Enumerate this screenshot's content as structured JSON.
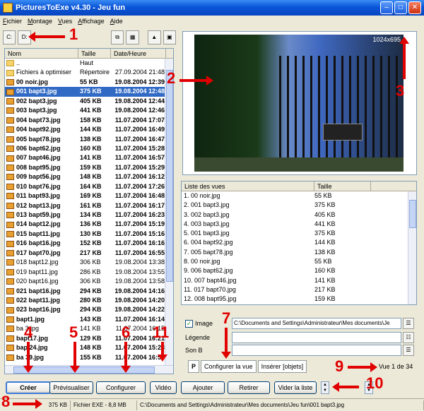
{
  "window": {
    "title": "PicturesToExe v4.30 - Jeu fun"
  },
  "menu": [
    "Fichier",
    "Montage",
    "Vues",
    "Affichage",
    "Aide"
  ],
  "file_list": {
    "columns": [
      "Nom",
      "Taille",
      "Date/Heure"
    ],
    "rows": [
      {
        "name": "..",
        "size": "Haut",
        "date": "",
        "icon": "folder",
        "bold": false,
        "selected": false
      },
      {
        "name": "Fichiers à optimiser",
        "size": "Répertoire",
        "date": "27.09.2004 21:48",
        "icon": "folder",
        "bold": false,
        "selected": false
      },
      {
        "name": "00 noir.jpg",
        "size": "55 KB",
        "date": "19.08.2004 12:39",
        "icon": "image",
        "bold": true,
        "selected": false
      },
      {
        "name": "001 bapt3.jpg",
        "size": "375 KB",
        "date": "19.08.2004 12:48",
        "icon": "image",
        "bold": true,
        "selected": true
      },
      {
        "name": "002 bapt3.jpg",
        "size": "405 KB",
        "date": "19.08.2004 12:44",
        "icon": "image",
        "bold": true,
        "selected": false
      },
      {
        "name": "003 bapt3.jpg",
        "size": "441 KB",
        "date": "19.08.2004 12:46",
        "icon": "image",
        "bold": true,
        "selected": false
      },
      {
        "name": "004 bapt73.jpg",
        "size": "158 KB",
        "date": "11.07.2004 17:07",
        "icon": "image",
        "bold": true,
        "selected": false
      },
      {
        "name": "004 bapt92.jpg",
        "size": "144 KB",
        "date": "11.07.2004 16:49",
        "icon": "image",
        "bold": true,
        "selected": false
      },
      {
        "name": "005 bapt78.jpg",
        "size": "138 KB",
        "date": "11.07.2004 16:47",
        "icon": "image",
        "bold": true,
        "selected": false
      },
      {
        "name": "006 bapt62.jpg",
        "size": "160 KB",
        "date": "11.07.2004 15:28",
        "icon": "image",
        "bold": true,
        "selected": false
      },
      {
        "name": "007 bapt46.jpg",
        "size": "141 KB",
        "date": "11.07.2004 16:57",
        "icon": "image",
        "bold": true,
        "selected": false
      },
      {
        "name": "008 bapt95.jpg",
        "size": "159 KB",
        "date": "11.07.2004 15:29",
        "icon": "image",
        "bold": true,
        "selected": false
      },
      {
        "name": "009 bapt56.jpg",
        "size": "148 KB",
        "date": "11.07.2004 16:12",
        "icon": "image",
        "bold": true,
        "selected": false
      },
      {
        "name": "010 bapt76.jpg",
        "size": "164 KB",
        "date": "11.07.2004 17:26",
        "icon": "image",
        "bold": true,
        "selected": false
      },
      {
        "name": "011 bapt93.jpg",
        "size": "169 KB",
        "date": "11.07.2004 16:48",
        "icon": "image",
        "bold": true,
        "selected": false
      },
      {
        "name": "012 bapt13.jpg",
        "size": "161 KB",
        "date": "11.07.2004 16:17",
        "icon": "image",
        "bold": true,
        "selected": false
      },
      {
        "name": "013 bapt59.jpg",
        "size": "134 KB",
        "date": "11.07.2004 16:23",
        "icon": "image",
        "bold": true,
        "selected": false
      },
      {
        "name": "014 bapt12.jpg",
        "size": "136 KB",
        "date": "11.07.2004 15:19",
        "icon": "image",
        "bold": true,
        "selected": false
      },
      {
        "name": "015 bapt11.jpg",
        "size": "130 KB",
        "date": "11.07.2004 15:16",
        "icon": "image",
        "bold": true,
        "selected": false
      },
      {
        "name": "016 bapt16.jpg",
        "size": "152 KB",
        "date": "11.07.2004 16:16",
        "icon": "image",
        "bold": true,
        "selected": false
      },
      {
        "name": "017 bapt70.jpg",
        "size": "217 KB",
        "date": "11.07.2004 16:55",
        "icon": "image",
        "bold": true,
        "selected": false
      },
      {
        "name": "018 bapt12.jpg",
        "size": "306 KB",
        "date": "19.08.2004 13:38",
        "icon": "image",
        "bold": false,
        "selected": false
      },
      {
        "name": "019 bapt11.jpg",
        "size": "286 KB",
        "date": "19.08.2004 13:55",
        "icon": "image",
        "bold": false,
        "selected": false
      },
      {
        "name": "020 bapt16.jpg",
        "size": "306 KB",
        "date": "19.08.2004 13:58",
        "icon": "image",
        "bold": false,
        "selected": false
      },
      {
        "name": "021 bapt16.jpg",
        "size": "294 KB",
        "date": "19.08.2004 14:16",
        "icon": "image",
        "bold": true,
        "selected": false
      },
      {
        "name": "022 bapt11.jpg",
        "size": "280 KB",
        "date": "19.08.2004 14:20",
        "icon": "image",
        "bold": true,
        "selected": false
      },
      {
        "name": "023 bapt16.jpg",
        "size": "294 KB",
        "date": "19.08.2004 14:22",
        "icon": "image",
        "bold": true,
        "selected": false
      },
      {
        "name": "bapt1.jpg",
        "size": "143 KB",
        "date": "11.07.2004 16:14",
        "icon": "image",
        "bold": true,
        "selected": false
      },
      {
        "name": "ba  3.jpg",
        "size": "141 KB",
        "date": "11.07.2004 16:15",
        "icon": "image",
        "bold": false,
        "selected": false
      },
      {
        "name": "bapt17.jpg",
        "size": "129 KB",
        "date": "11.07.2004 16:21",
        "icon": "image",
        "bold": true,
        "selected": false
      },
      {
        "name": "bap 24.jpg",
        "size": "148 KB",
        "date": "11.07.2004 15:23",
        "icon": "image",
        "bold": true,
        "selected": false
      },
      {
        "name": "ba  39.jpg",
        "size": "155 KB",
        "date": "11.07.2004 16:53",
        "icon": "image",
        "bold": true,
        "selected": false
      }
    ]
  },
  "preview": {
    "resolution": "1024x695"
  },
  "view_list": {
    "columns": [
      "Liste des vues",
      "Taille"
    ],
    "rows": [
      {
        "name": "1. 00 noir.jpg",
        "size": "55 KB"
      },
      {
        "name": "2. 001 bapt3.jpg",
        "size": "375 KB"
      },
      {
        "name": "3. 002 bapt3.jpg",
        "size": "405 KB"
      },
      {
        "name": "4. 003 bapt3.jpg",
        "size": "441 KB"
      },
      {
        "name": "5. 001 bapt3.jpg",
        "size": "375 KB"
      },
      {
        "name": "6. 004 bapt92.jpg",
        "size": "144 KB"
      },
      {
        "name": "7. 005 bapt78.jpg",
        "size": "138 KB"
      },
      {
        "name": "8. 00 noir.jpg",
        "size": "55 KB"
      },
      {
        "name": "9. 006 bapt62.jpg",
        "size": "160 KB"
      },
      {
        "name": "10. 007 bapt46.jpg",
        "size": "141 KB"
      },
      {
        "name": "11. 017 bapt70.jpg",
        "size": "217 KB"
      },
      {
        "name": "12. 008 bapt95.jpg",
        "size": "159 KB"
      }
    ]
  },
  "properties": {
    "image_label": "Image",
    "image_checked": true,
    "image_path": "C:\\Documents and Settings\\Administrateur\\Mes documents\\Je",
    "legende_label": "Légende",
    "legende_value": "",
    "son_label": "Son B",
    "son_value": ""
  },
  "tabs": {
    "p": "P",
    "configure": "Configurer la vue",
    "insert": "Insérer [objets]"
  },
  "view_counter": "Vue 1 de 34",
  "buttons": {
    "creer": "Créer",
    "previsualiser": "Prévisualiser",
    "configurer": "Configurer",
    "video": "Vidéo",
    "ajouter": "Ajouter",
    "retirer": "Retirer",
    "vider": "Vider la liste"
  },
  "status": {
    "size": "375 KB",
    "exe": "Fichier EXE - 8,8 MB",
    "path": "C:\\Documents and Settings\\Administrateur\\Mes documents\\Jeu fun\\001 bapt3.jpg"
  },
  "annotations": [
    "1",
    "2",
    "3",
    "4",
    "5",
    "6",
    "7",
    "8",
    "9",
    "10",
    "11"
  ],
  "colors": {
    "selection": "#316ac5",
    "annotation": "#e00000",
    "titlebar": "#0a56d8"
  }
}
